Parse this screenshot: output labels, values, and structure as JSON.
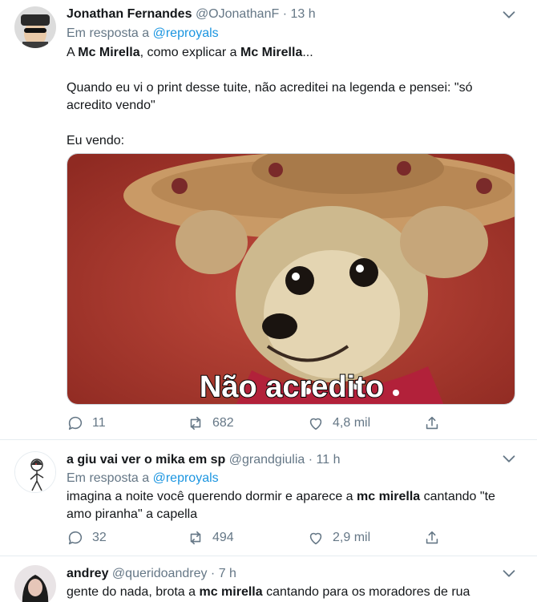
{
  "tweets": [
    {
      "name": "Jonathan Fernandes",
      "handle": "@OJonathanF",
      "separator": "·",
      "time": "13 h",
      "reply_prefix": "Em resposta a",
      "reply_to": "@reproyals",
      "line1_a": "A ",
      "line1_b": "Mc Mirella",
      "line1_c": ", como explicar a ",
      "line1_d": "Mc Mirella",
      "line1_e": "...",
      "line2": "Quando eu vi o print desse tuite, não acreditei na legenda e pensei: \"só acredito vendo\"",
      "line3": "Eu vendo:",
      "media_caption": "Não acredito",
      "replies": "11",
      "retweets": "682",
      "likes": "4,8 mil"
    },
    {
      "name": "a giu vai ver o mika em sp",
      "handle": "@grandgiulia",
      "separator": "·",
      "time": "11 h",
      "reply_prefix": "Em resposta a",
      "reply_to": "@reproyals",
      "text_a": "imagina a noite você querendo dormir e aparece a ",
      "text_b": "mc mirella",
      "text_c": " cantando \"te amo piranha\" a capella",
      "replies": "32",
      "retweets": "494",
      "likes": "2,9 mil"
    },
    {
      "name": "andrey",
      "handle": "@queridoandrey",
      "separator": "·",
      "time": "7 h",
      "text_a": "gente do nada, brota a ",
      "text_b": "mc mirella",
      "text_c": " cantando para os moradores de rua"
    }
  ],
  "colors": {
    "text": "#14171a",
    "muted": "#657786",
    "link": "#1b95e0",
    "divider": "#e6ecf0"
  },
  "icons": [
    "reply-icon",
    "retweet-icon",
    "like-icon",
    "share-icon",
    "chevron-down-icon"
  ]
}
